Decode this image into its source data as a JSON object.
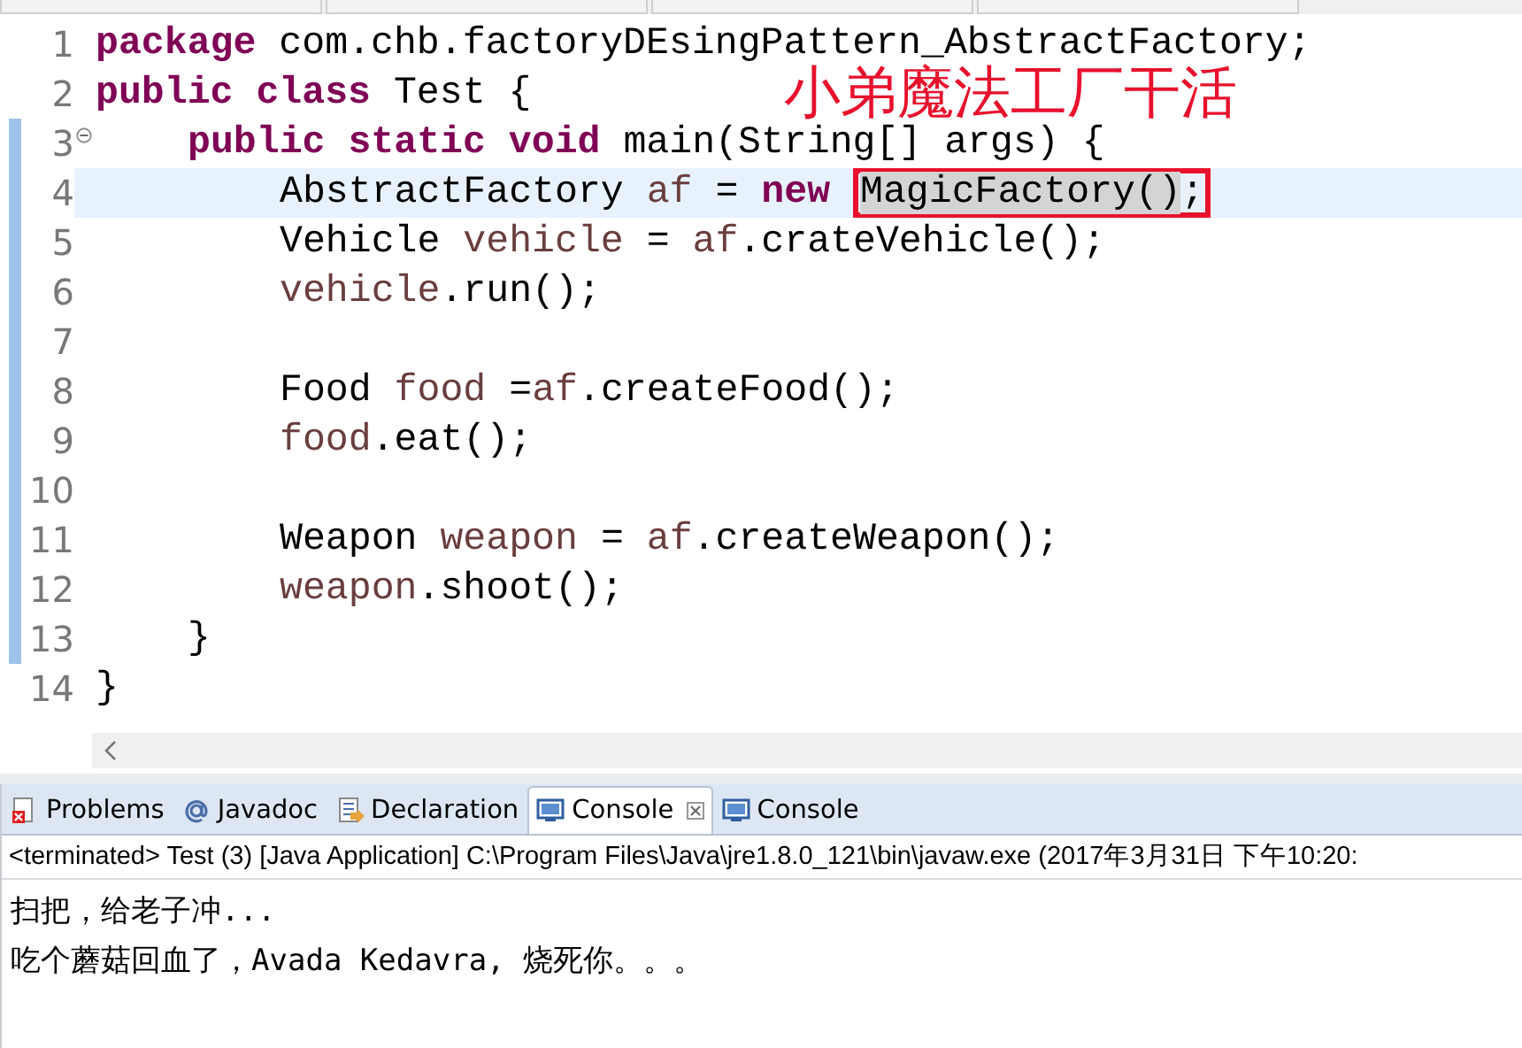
{
  "editor": {
    "lines": [
      {
        "number": "1",
        "current": false,
        "changed": false,
        "foldable": false,
        "tokens": [
          {
            "text": "package",
            "kind": "keyword"
          },
          {
            "text": " com.chb.factoryDEsingPattern_AbstractFactory;",
            "kind": "plain"
          }
        ]
      },
      {
        "number": "2",
        "current": false,
        "changed": false,
        "foldable": false,
        "tokens": [
          {
            "text": "public class",
            "kind": "keyword"
          },
          {
            "text": " Test {",
            "kind": "plain"
          }
        ],
        "children": [
          {
            "number": "3",
            "current": false,
            "changed": true,
            "foldable": true,
            "tokens": [
              {
                "text": "public static void",
                "kind": "keyword"
              },
              {
                "text": " main(String[] args) {",
                "kind": "plain"
              }
            ],
            "children": [
              {
                "number": "4",
                "current": true,
                "changed": true,
                "foldable": false,
                "tokens": [
                  {
                    "text": "AbstractFactory ",
                    "kind": "plain"
                  },
                  {
                    "text": "af",
                    "kind": "variable"
                  },
                  {
                    "text": " = ",
                    "kind": "plain"
                  },
                  {
                    "text": "new ",
                    "kind": "keyword"
                  },
                  {
                    "kind": "boxed",
                    "tokens": [
                      {
                        "text": "MagicFactory()",
                        "kind": "highlighted"
                      },
                      {
                        "text": ";",
                        "kind": "plain"
                      }
                    ]
                  }
                ]
              },
              {
                "number": "5",
                "current": false,
                "changed": true,
                "foldable": false,
                "tokens": [
                  {
                    "text": "Vehicle ",
                    "kind": "plain"
                  },
                  {
                    "text": "vehicle",
                    "kind": "variable"
                  },
                  {
                    "text": " = ",
                    "kind": "plain"
                  },
                  {
                    "text": "af",
                    "kind": "variable"
                  },
                  {
                    "text": ".crateVehicle();",
                    "kind": "plain"
                  }
                ]
              },
              {
                "number": "6",
                "current": false,
                "changed": true,
                "foldable": false,
                "tokens": [
                  {
                    "text": "vehicle",
                    "kind": "variable"
                  },
                  {
                    "text": ".run();",
                    "kind": "plain"
                  }
                ]
              },
              {
                "number": "7",
                "current": false,
                "changed": true,
                "foldable": false
              },
              {
                "number": "8",
                "current": false,
                "changed": true,
                "foldable": false,
                "tokens": [
                  {
                    "text": "Food ",
                    "kind": "plain"
                  },
                  {
                    "text": "food",
                    "kind": "variable"
                  },
                  {
                    "text": " =",
                    "kind": "plain"
                  },
                  {
                    "text": "af",
                    "kind": "variable"
                  },
                  {
                    "text": ".createFood();",
                    "kind": "plain"
                  }
                ]
              },
              {
                "number": "9",
                "current": false,
                "changed": true,
                "foldable": false,
                "tokens": [
                  {
                    "text": "food",
                    "kind": "variable"
                  },
                  {
                    "text": ".eat();",
                    "kind": "plain"
                  }
                ]
              },
              {
                "number": "10",
                "current": false,
                "changed": true,
                "foldable": false
              },
              {
                "number": "11",
                "current": false,
                "changed": true,
                "foldable": false,
                "tokens": [
                  {
                    "text": "Weapon ",
                    "kind": "plain"
                  },
                  {
                    "text": "weapon",
                    "kind": "variable"
                  },
                  {
                    "text": " = ",
                    "kind": "plain"
                  },
                  {
                    "text": "af",
                    "kind": "variable"
                  },
                  {
                    "text": ".createWeapon();",
                    "kind": "plain"
                  }
                ]
              },
              {
                "number": "12",
                "current": false,
                "changed": true,
                "foldable": false,
                "tokens": [
                  {
                    "text": "weapon",
                    "kind": "variable"
                  },
                  {
                    "text": ".shoot();",
                    "kind": "plain"
                  }
                ]
              }
            ]
          },
          {
            "number": "13",
            "current": false,
            "changed": true,
            "foldable": false,
            "tokens": [
              {
                "text": "}",
                "kind": "plain"
              }
            ]
          }
        ]
      },
      {
        "number": "14",
        "current": false,
        "changed": false,
        "foldable": false,
        "tokens": [
          {
            "text": "}",
            "kind": "plain"
          }
        ]
      }
    ],
    "annotation": "小弟魔法工厂干活"
  },
  "panel": {
    "tabs": [
      {
        "label": "Problems",
        "kind": "problems",
        "selected": false,
        "closable": false
      },
      {
        "label": "Javadoc",
        "kind": "javadoc",
        "selected": false,
        "closable": false
      },
      {
        "label": "Declaration",
        "kind": "declaration",
        "selected": false,
        "closable": false
      },
      {
        "label": "Console",
        "kind": "console",
        "selected": true,
        "closable": true
      },
      {
        "label": "Console",
        "kind": "console",
        "selected": false,
        "closable": false
      }
    ],
    "header": "<terminated> Test (3) [Java Application] C:\\Program Files\\Java\\jre1.8.0_121\\bin\\javaw.exe (2017年3月31日 下午10:20:",
    "output": [
      "扫把，给老子冲...",
      "吃个蘑菇回血了，Avada Kedavra, 烧死你。。。"
    ]
  }
}
